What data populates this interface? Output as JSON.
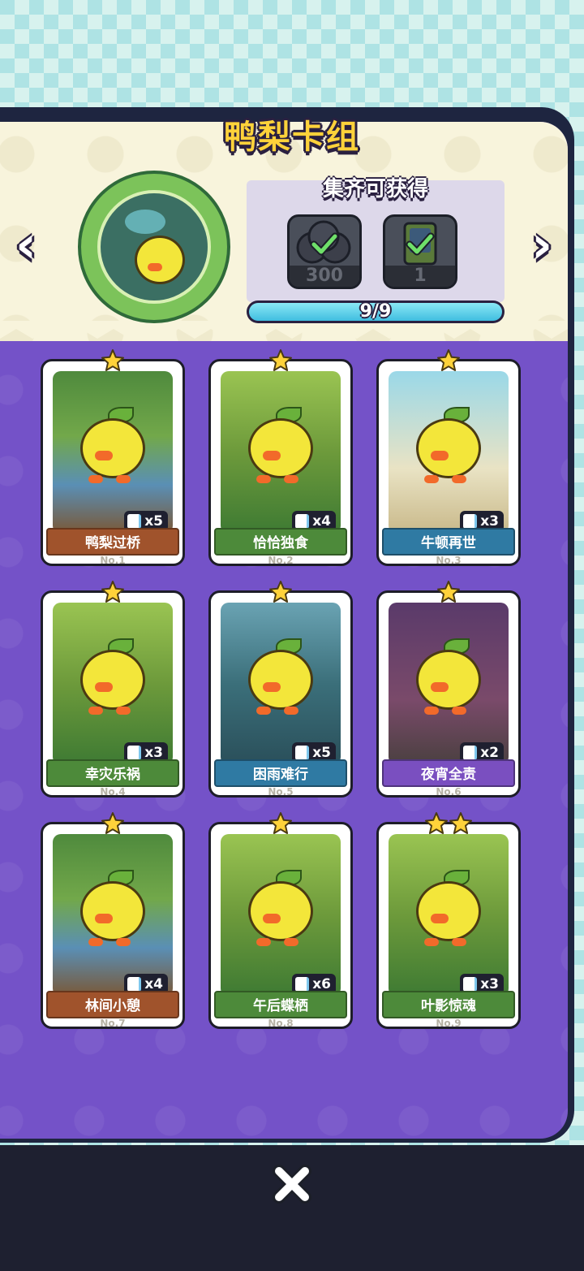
{
  "title": "鸭梨卡组",
  "nav": {
    "prev": "‹",
    "next": "›"
  },
  "reward": {
    "title": "集齐可获得",
    "items": [
      {
        "icon": "coin-bubbles-icon",
        "amount": "300"
      },
      {
        "icon": "card-pack-icon",
        "amount": "1"
      }
    ]
  },
  "progress": {
    "text": "9/9",
    "value": 1.0
  },
  "cards": [
    {
      "name": "鸭梨过桥",
      "no": "No.1",
      "count": "x5",
      "stars": 1,
      "theme": "brown"
    },
    {
      "name": "恰恰独食",
      "no": "No.2",
      "count": "x4",
      "stars": 1,
      "theme": "green"
    },
    {
      "name": "牛顿再世",
      "no": "No.3",
      "count": "x3",
      "stars": 1,
      "theme": "blue"
    },
    {
      "name": "幸灾乐祸",
      "no": "No.4",
      "count": "x3",
      "stars": 1,
      "theme": "green"
    },
    {
      "name": "困雨难行",
      "no": "No.5",
      "count": "x5",
      "stars": 1,
      "theme": "blue"
    },
    {
      "name": "夜宵全责",
      "no": "No.6",
      "count": "x2",
      "stars": 1,
      "theme": "purple"
    },
    {
      "name": "林间小憩",
      "no": "No.7",
      "count": "x4",
      "stars": 1,
      "theme": "brown"
    },
    {
      "name": "午后蝶栖",
      "no": "No.8",
      "count": "x6",
      "stars": 1,
      "theme": "green"
    },
    {
      "name": "叶影惊魂",
      "no": "No.9",
      "count": "x3",
      "stars": 2,
      "theme": "green"
    }
  ],
  "colors": {
    "brown": "#a0532c",
    "green": "#4d8a3a",
    "blue": "#2f7aa3",
    "purple": "#7a4fc0",
    "accent": "#ffd23a"
  },
  "close": {
    "icon": "close-icon"
  }
}
